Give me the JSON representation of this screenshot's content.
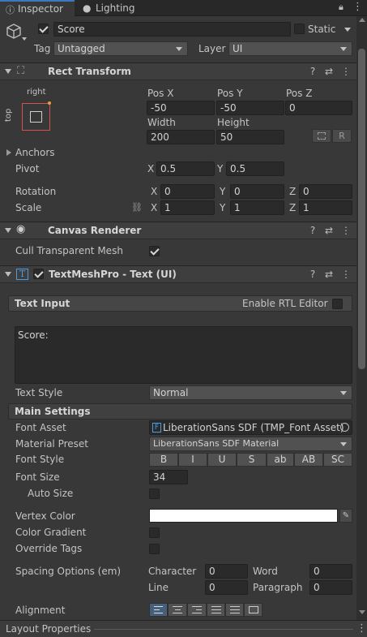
{
  "tabs": [
    {
      "label": "Inspector",
      "icon": "info-icon",
      "active": true
    },
    {
      "label": "Lighting",
      "icon": "bulb-icon",
      "active": false
    }
  ],
  "gameobject": {
    "name": "Score",
    "static_label": "Static",
    "tag_label": "Tag",
    "tag_value": "Untagged",
    "layer_label": "Layer",
    "layer_value": "UI"
  },
  "rect_transform": {
    "title": "Rect Transform",
    "anchor_h": "right",
    "anchor_v": "top",
    "posx_label": "Pos X",
    "posy_label": "Pos Y",
    "posz_label": "Pos Z",
    "posx": "-50",
    "posy": "-50",
    "posz": "0",
    "width_label": "Width",
    "height_label": "Height",
    "width": "200",
    "height": "50",
    "r_label": "R",
    "anchors_label": "Anchors",
    "pivot_label": "Pivot",
    "pivot_x": "0.5",
    "pivot_y": "0.5",
    "rotation_label": "Rotation",
    "rot_x": "0",
    "rot_y": "0",
    "rot_z": "0",
    "scale_label": "Scale",
    "scale_x": "1",
    "scale_y": "1",
    "scale_z": "1",
    "x": "X",
    "y": "Y",
    "z": "Z"
  },
  "canvas_renderer": {
    "title": "Canvas Renderer",
    "cull_label": "Cull Transparent Mesh",
    "cull_checked": true
  },
  "tmp": {
    "title": "TextMeshPro - Text (UI)",
    "text_input_label": "Text Input",
    "rtl_label": "Enable RTL Editor",
    "text_value": "Score:",
    "text_style_label": "Text Style",
    "text_style_value": "Normal",
    "main_settings_label": "Main Settings",
    "font_asset_label": "Font Asset",
    "font_asset_value": "LiberationSans SDF (TMP_Font Asset)",
    "material_preset_label": "Material Preset",
    "material_preset_value": "LiberationSans SDF Material",
    "font_style_label": "Font Style",
    "font_style_buttons": [
      "B",
      "I",
      "U",
      "S",
      "ab",
      "AB",
      "SC"
    ],
    "font_size_label": "Font Size",
    "font_size_value": "34",
    "auto_size_label": "Auto Size",
    "vertex_color_label": "Vertex Color",
    "vertex_color": "#ffffff",
    "color_gradient_label": "Color Gradient",
    "override_tags_label": "Override Tags",
    "spacing_label": "Spacing Options (em)",
    "character_label": "Character",
    "character_value": "0",
    "word_label": "Word",
    "word_value": "0",
    "line_label": "Line",
    "line_value": "0",
    "paragraph_label": "Paragraph",
    "paragraph_value": "0",
    "alignment_label": "Alignment"
  },
  "footer": {
    "label": "Layout Properties"
  },
  "colors": {
    "accent": "#3a79bb",
    "background": "#383838",
    "field": "#2a2a2a"
  }
}
